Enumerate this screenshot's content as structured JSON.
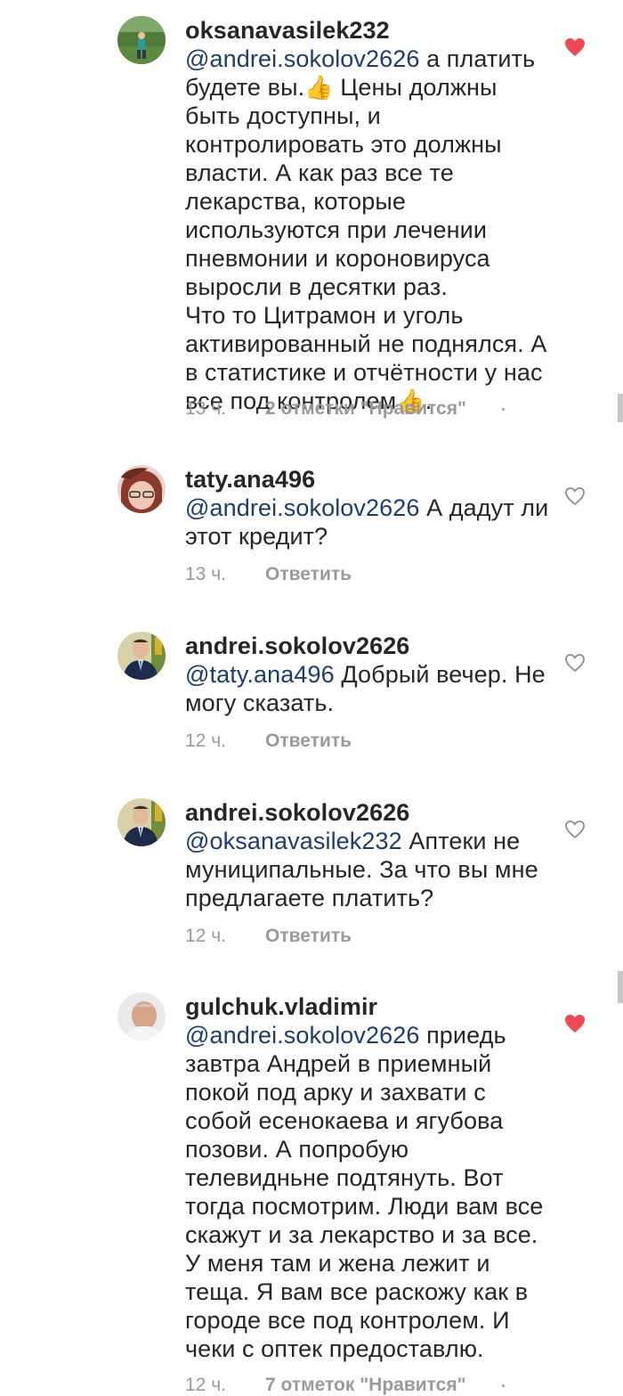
{
  "comments": [
    {
      "username": "oksanavasilek232",
      "mention": "@andrei.sokolov2626",
      "text_a": " а платить будете вы.",
      "text_b": " Цены должны быть доступны, и контролировать это должны власти. А как раз все те лекарства, которые используются при лечении пневмонии и короновируса выросли в десятки раз.\nЧто то Цитрамон и уголь активированный не поднялся. А в статистике и отчётности у нас все под контролем",
      "text_c": ".",
      "time": "13 ч.",
      "action": "2 отметки \"Нравится\"",
      "liked": true,
      "heart_icon": "heart-filled-icon"
    },
    {
      "username": "taty.ana496",
      "mention": "@andrei.sokolov2626",
      "text_a": " А дадут ли этот кредит?",
      "time": "13 ч.",
      "action": "Ответить",
      "liked": false,
      "heart_icon": "heart-outline-icon"
    },
    {
      "username": "andrei.sokolov2626",
      "mention": "@taty.ana496",
      "text_a": " Добрый вечер. Не могу сказать.",
      "time": "12 ч.",
      "action": "Ответить",
      "liked": false,
      "heart_icon": "heart-outline-icon"
    },
    {
      "username": "andrei.sokolov2626",
      "mention": "@oksanavasilek232",
      "text_a": " Аптеки не муниципальные. За что вы мне предлагаете платить?",
      "time": "12 ч.",
      "action": "Ответить",
      "liked": false,
      "heart_icon": "heart-outline-icon"
    },
    {
      "username": "gulchuk.vladimir",
      "mention": "@andrei.sokolov2626",
      "text_a": " приедь завтра Андрей в приемный покой под арку и захвати с собой есенокаева и ягубова позови. А попробую телевидньне подтянуть. Вот тогда посмотрим. Люди вам все скажут и за лекарство и за все. У меня там и жена лежит и теща. Я вам все раскожу как в городе все под контролем. И чеки с оптек предоставлю.",
      "time": "12 ч.",
      "action": "7 отметок \"Нравится\"",
      "liked": true,
      "heart_icon": "heart-filled-icon"
    }
  ],
  "colors": {
    "heart_liked": "#ed4956",
    "heart_outline": "#8e8e8e",
    "mention": "#1b3e6f",
    "meta": "#9a9a9a"
  }
}
